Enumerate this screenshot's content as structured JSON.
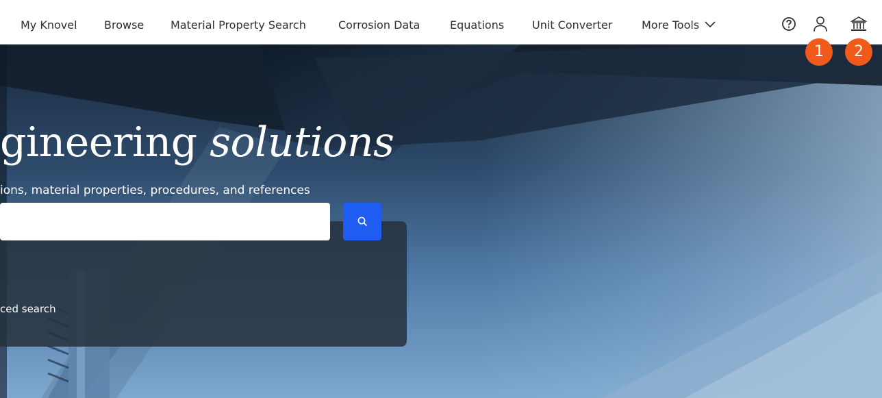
{
  "nav": {
    "items": [
      {
        "label": "My Knovel"
      },
      {
        "label": "Browse"
      },
      {
        "label": "Material Property Search"
      },
      {
        "label": "Corrosion Data"
      },
      {
        "label": "Equations"
      },
      {
        "label": "Unit Converter"
      },
      {
        "label": "More Tools"
      }
    ],
    "icons": [
      "help-icon",
      "user-icon",
      "institution-icon"
    ]
  },
  "badges": [
    "1",
    "2"
  ],
  "hero": {
    "headline_plain": "gineering ",
    "headline_italic": "solutions",
    "subline": "ions, material properties, procedures, and references"
  },
  "search": {
    "value": "",
    "advanced_label": "ced search"
  },
  "colors": {
    "accent": "#1f5cf2",
    "badge": "#f05a1a",
    "panel": "#26303c"
  }
}
